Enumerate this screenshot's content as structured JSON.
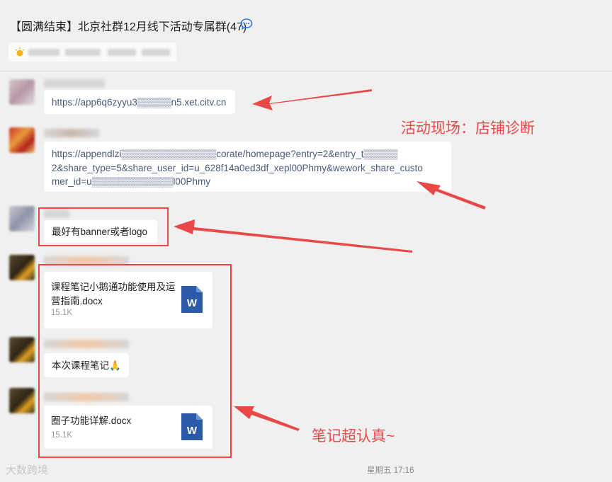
{
  "header": {
    "group_title": "【圆满结束】北京社群12月线下活动专属群(47)",
    "chat_icon": "group-chat-icon",
    "notice_icon": "sun-icon"
  },
  "messages": [
    {
      "type": "link",
      "text": "https://app6q6zyyu3▒▒▒▒▒n5.xet.citv.cn"
    },
    {
      "type": "link",
      "lines": [
        "https://appendlzi▒▒▒▒▒▒▒▒▒▒▒▒▒▒corate/homepage?entry=2&entry_t▒▒▒▒▒",
        "2&share_type=5&share_user_id=u_628f14a0ed3df_xepl00Phmy&wework_share_custo",
        "mer_id=u▒▒▒▒▒▒▒▒▒▒▒▒l00Phmy"
      ]
    },
    {
      "type": "text",
      "text": "最好有banner或者logo"
    },
    {
      "type": "file",
      "name": "课程笔记小鹅通功能使用及运营指南.docx",
      "size": "15.1K",
      "icon": "word-file-icon"
    },
    {
      "type": "text",
      "text": "本次课程笔记🙏"
    },
    {
      "type": "file",
      "name": "圈子功能详解.docx",
      "size": "15.1K",
      "icon": "word-file-icon"
    }
  ],
  "annotations": {
    "scene": "活动现场：店铺诊断",
    "notes": "笔记超认真~",
    "color": "#ec4a4a"
  },
  "timestamp": "星期五 17:16",
  "watermark": "大数跨境"
}
